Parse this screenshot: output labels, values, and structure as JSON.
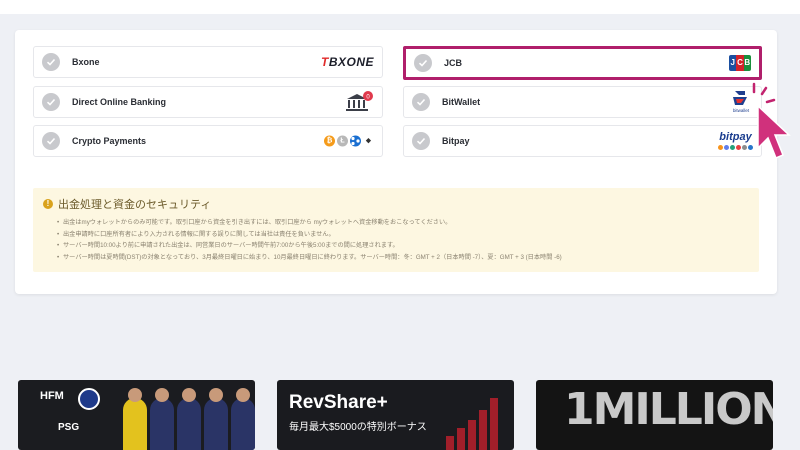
{
  "payment_options": [
    {
      "label": "Bxone",
      "logo": "Bxone"
    },
    {
      "label": "JCB",
      "logo": "JCB",
      "selected": true
    },
    {
      "label": "Direct Online Banking",
      "logo": "bank-icon"
    },
    {
      "label": "BitWallet",
      "logo": "bitwallet-logo"
    },
    {
      "label": "Crypto Payments",
      "logo": "crypto-coins"
    },
    {
      "label": "Bitpay",
      "logo": "bitpay"
    }
  ],
  "logos": {
    "bxone_t": "T",
    "bxone_text": "BXONE",
    "jcb": [
      "J",
      "C",
      "B"
    ],
    "bank_badge": "0",
    "bitwallet_text": "bitwallet",
    "bitpay_word": "bitpay",
    "coins": [
      "₿",
      "Ł",
      "◆"
    ]
  },
  "notice": {
    "title": "出金処理と資金のセキュリティ",
    "icon": "!",
    "items": [
      "出金はmyウォレットからのみ可能です。取引口座から資金を引き出すには、取引口座から myウォレットへ資金移動をおこなってください。",
      "出金申請時に口座所有者により入力される情報に関する誤りに関しては当社は責任を負いません。",
      "サーバー時間10:00より前に申請された出金は、同営業日のサーバー時間午前7:00から午後5:00までの間に処理されます。",
      "サーバー時間は夏時間(DST)の対象となっており、3月最終日曜日に始まり、10月最終日曜日に終わります。サーバー時間：冬：GMT + 2（日本時間 -7）、夏：GMT + 3 (日本時間 -6)"
    ]
  },
  "banners": {
    "b1": {
      "brand": "HFM",
      "club": "PSG"
    },
    "b2": {
      "title": "RevShare+",
      "subtitle": "毎月最大$5000の特別ボーナス"
    },
    "b3": {
      "title": "1MILLION"
    }
  },
  "colors": {
    "accent": "#b01f6b",
    "notice_bg": "#fdf7e1",
    "page_bg": "#eef0f5"
  }
}
